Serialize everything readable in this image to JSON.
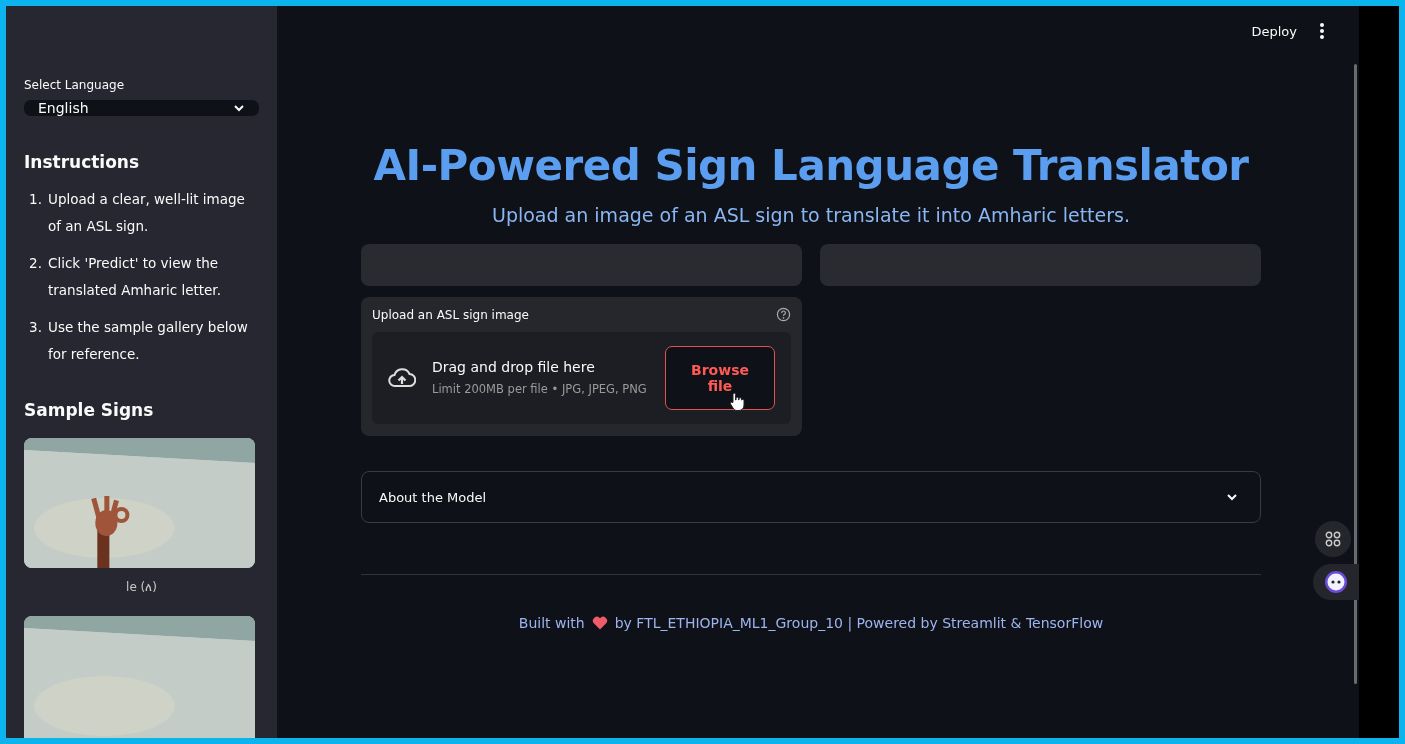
{
  "header": {
    "deploy": "Deploy"
  },
  "sidebar": {
    "language_label": "Select Language",
    "language": {
      "value": "English"
    },
    "instructions_title": "Instructions",
    "instructions": [
      {
        "number": "1.",
        "text": "Upload a clear, well-lit image of an ASL sign."
      },
      {
        "number": "2.",
        "text": "Click 'Predict' to view the translated Amharic letter."
      },
      {
        "number": "3.",
        "text": "Use the sample gallery below for reference."
      }
    ],
    "samples_title": "Sample Signs",
    "samples": [
      {
        "kind": "picture",
        "caption": "le (ለ)"
      },
      {
        "kind": "picture"
      }
    ]
  },
  "main": {
    "title": "AI-Powered Sign Language Translator",
    "subtitle": "Upload an image of an ASL sign to translate it into Amharic letters.",
    "uploader": {
      "label": "Upload an ASL sign image",
      "drop_text": "Drag and drop file here",
      "limit": "Limit 200MB per file • JPG, JPEG, PNG",
      "button": "Browse file"
    },
    "expander": {
      "label": "About the Model",
      "expanded": false
    },
    "footer": {
      "before": "Built with",
      "after": "by FTL_ETHIOPIA_ML1_Group_10 | Powered by Streamlit & TensorFlow"
    }
  }
}
